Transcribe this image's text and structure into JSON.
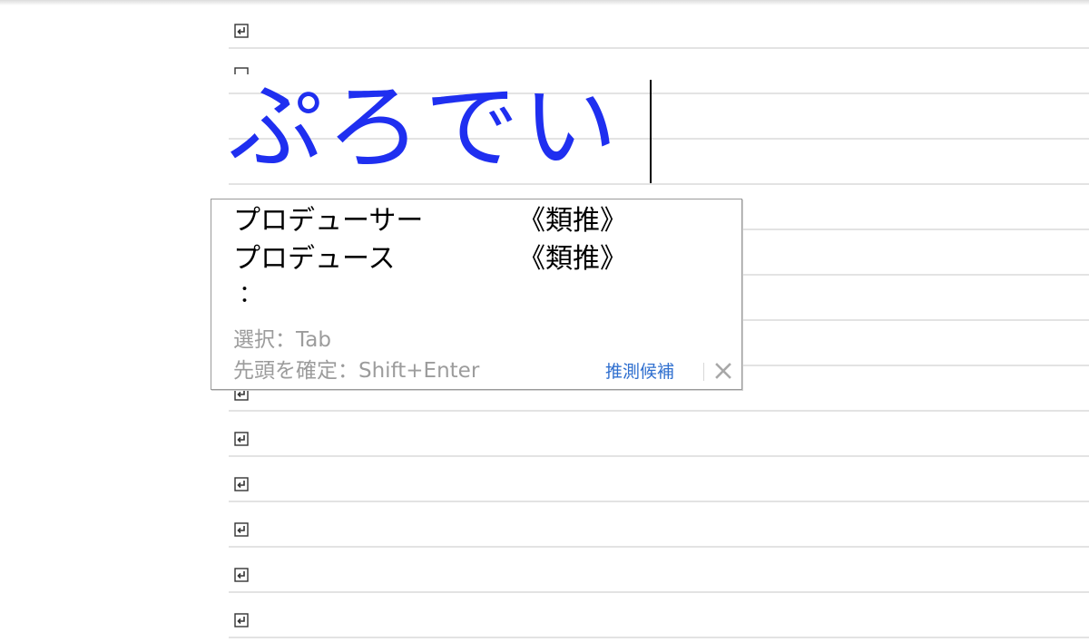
{
  "document": {
    "composition_text": "ぷろでい",
    "paragraph_mark_icon": "paragraph-return-icon"
  },
  "suggest": {
    "candidates": [
      {
        "word": "プロデューサー",
        "tag": "《類推》"
      },
      {
        "word": "プロデュース",
        "tag": "《類推》"
      }
    ],
    "more_marker": "：",
    "hint_select": "選択：Tab",
    "hint_confirm": "先頭を確定：Shift+Enter",
    "mode_label": "推測候補",
    "close_icon": "close-icon"
  },
  "colors": {
    "composition": "#1f2ff0",
    "hint": "#9c9c9c",
    "link": "#2f6fcf"
  }
}
